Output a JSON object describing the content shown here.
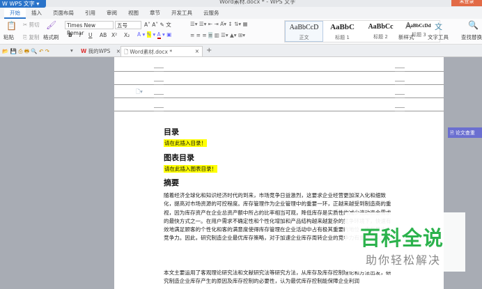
{
  "titlebar": {
    "app": "WPS 文字",
    "title": "Word素材.docx * - WPS 文字",
    "signin": "未登录"
  },
  "tabs": [
    "开始",
    "插入",
    "页面布局",
    "引用",
    "审阅",
    "视图",
    "章节",
    "开发工具",
    "云服务"
  ],
  "ribbon": {
    "paste": "粘贴",
    "cut": "剪切",
    "copy": "复制",
    "format_painter": "格式刷",
    "font": "Times New Romar",
    "size": "五号",
    "bold": "B",
    "italic": "I",
    "underline": "U",
    "strike": "AB",
    "sup": "X²",
    "sub": "X₂",
    "styles": [
      {
        "sample": "AaBbCcD",
        "label": "正文"
      },
      {
        "sample": "AaBbC",
        "label": "标题 1"
      },
      {
        "sample": "AaBbCc",
        "label": "标题 2"
      },
      {
        "sample": "AaBbCcDd",
        "label": "标题 3"
      }
    ],
    "new_style": "新样式",
    "text_tools": "文字工具",
    "find_replace": "查找替换"
  },
  "doc_tabs": [
    {
      "label": "我的WPS"
    },
    {
      "label": "Word素材.docx *"
    }
  ],
  "document": {
    "toc_heading": "目录",
    "toc_placeholder": "请在此插入目录！",
    "fig_heading": "图表目录",
    "fig_placeholder": "请在此插入图表目录！",
    "abstract_heading": "摘要",
    "para1": "随着经济全球化和知识经济时代的到来，市场竞争日益激烈，这要求企业经营更加深入化和细致化，提高对市场资源的可控程度。库存管理作为企业管理中的重要一环，正越来越受到制造商的重视，因为库存资产在企业总资产额中所占的比率相当可观，降低库存是实质性的减少流动资金需求的最快方式之一。在用户需求不确定性和个性化增加和产品结构越来越复杂的竞争环境下，快速有效地满足顾客的个性化和客的满意度使得库存管理在企业活动中占有极其重要的地位，库存量太业竞争力。因此，研究制造企业最优库存策略，对于加速企业库存周转企业的竞争力有重要意义。",
    "para2": "本文主要运用了客观理论研究法和文献研究法等研究方法，从库存及库存控制理论和方法出发，研究制造企业库存产生的原因及库存控制的必要性，认为最优库存控制能保障企业利润"
  },
  "side_button": "论文查重",
  "watermark": {
    "title": "百科全说",
    "subtitle": "助你轻松解决"
  }
}
